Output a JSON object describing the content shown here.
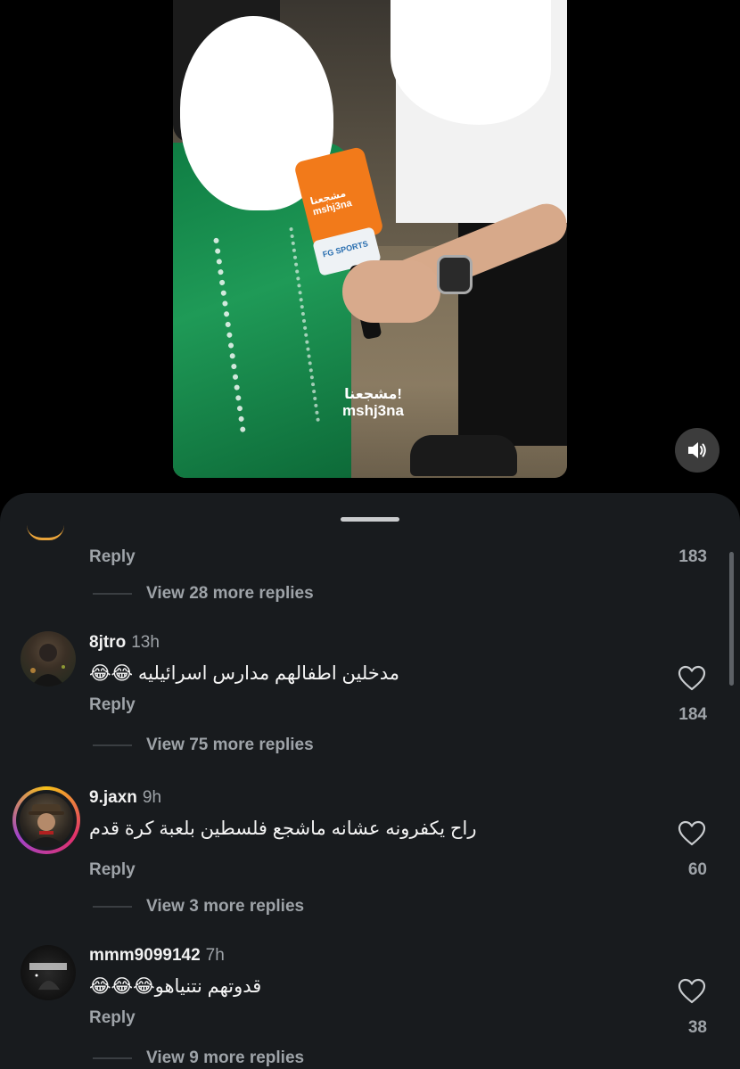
{
  "video": {
    "mic_cube_text": "مشجعنا mshj3na",
    "mic_band_text": "FG SPORTS",
    "watermark_ar": "مشجعنا!",
    "watermark_en": "mshj3na",
    "sound_icon": "speaker-on-icon"
  },
  "thread_top": {
    "reply_label": "Reply",
    "like_count": "183",
    "view_more": "View 28 more replies"
  },
  "comments": [
    {
      "username": "8jtro",
      "time": "13h",
      "text": "مدخلين اطفالهم مدارس اسرائيليه 😂😂",
      "reply_label": "Reply",
      "like_count": "184",
      "view_more": "View 75 more replies"
    },
    {
      "username": "9.jaxn",
      "time": "9h",
      "text": "راح يكفرونه عشانه ماشجع فلسطين بلعبة كرة قدم",
      "reply_label": "Reply",
      "like_count": "60",
      "view_more": "View 3 more replies"
    },
    {
      "username": "mmm9099142",
      "time": "7h",
      "text": "قدوتهم نتنياهو😂😂😂",
      "reply_label": "Reply",
      "like_count": "38",
      "view_more": "View 9 more replies"
    }
  ],
  "colors": {
    "sheet_bg": "#181b1e",
    "muted_text": "#9ea3a8",
    "primary_text": "#f4f4f4"
  }
}
